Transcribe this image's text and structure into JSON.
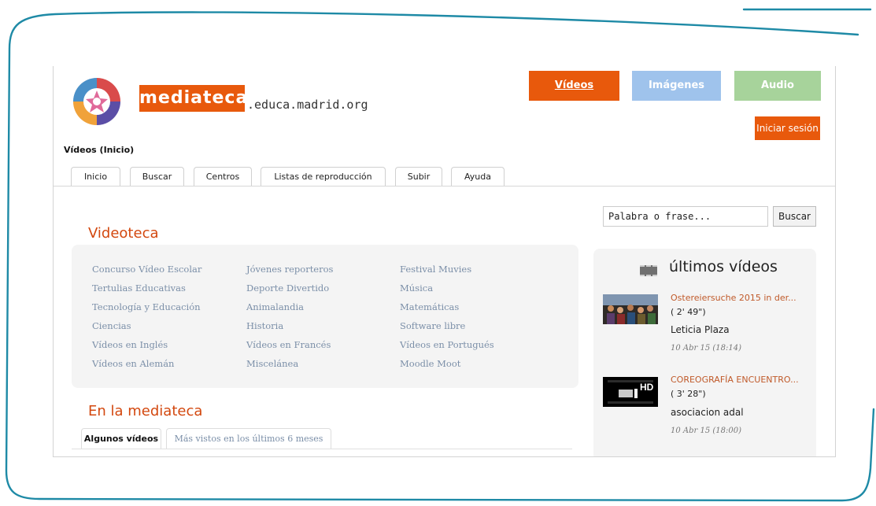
{
  "brand": {
    "name": "mediateca",
    "domain": ".educa.madrid.org"
  },
  "top_tabs": {
    "videos": "Vídeos",
    "images": "Imágenes",
    "audio": "Audio"
  },
  "login_label": "Iniciar sesión",
  "breadcrumb": "Vídeos (Inicio)",
  "nav_tabs": [
    "Inicio",
    "Buscar",
    "Centros",
    "Listas de reproducción",
    "Subir",
    "Ayuda"
  ],
  "search": {
    "placeholder": "Palabra o frase...",
    "button": "Buscar"
  },
  "videoteca": {
    "title": "Videoteca",
    "columns": [
      [
        "Concurso Vídeo Escolar",
        "Tertulias Educativas",
        "Tecnología y Educación",
        "Ciencias",
        "Vídeos en Inglés",
        "Vídeos en Alemán"
      ],
      [
        "Jóvenes reporteros",
        "Deporte Divertido",
        "Animalandia",
        "Historia",
        "Vídeos en Francés",
        "Miscelánea"
      ],
      [
        "Festival Muvies",
        "Música",
        "Matemáticas",
        "Software libre",
        "Vídeos en Portugués",
        "Moodle Moot"
      ]
    ]
  },
  "en_mediateca": {
    "title": "En la mediateca",
    "tabs": [
      "Algunos vídeos",
      "Más vistos en los últimos 6 meses"
    ]
  },
  "latest": {
    "title": "últimos vídeos",
    "items": [
      {
        "title": "Ostereiersuche 2015 in der...",
        "duration": "( 2' 49\")",
        "author": "Leticia Plaza",
        "date": "10 Abr 15 (18:14)"
      },
      {
        "title": "COREOGRAFÍA ENCUENTRO...",
        "duration": "( 3' 28\")",
        "author": "asociacion adal",
        "date": "10 Abr 15 (18:00)"
      }
    ]
  },
  "thumb2_badge": "HD",
  "colors": {
    "accent": "#e8590c",
    "images_tab": "#9fc3ec",
    "audio_tab": "#a7d39b",
    "frame": "#1e8aa6"
  }
}
